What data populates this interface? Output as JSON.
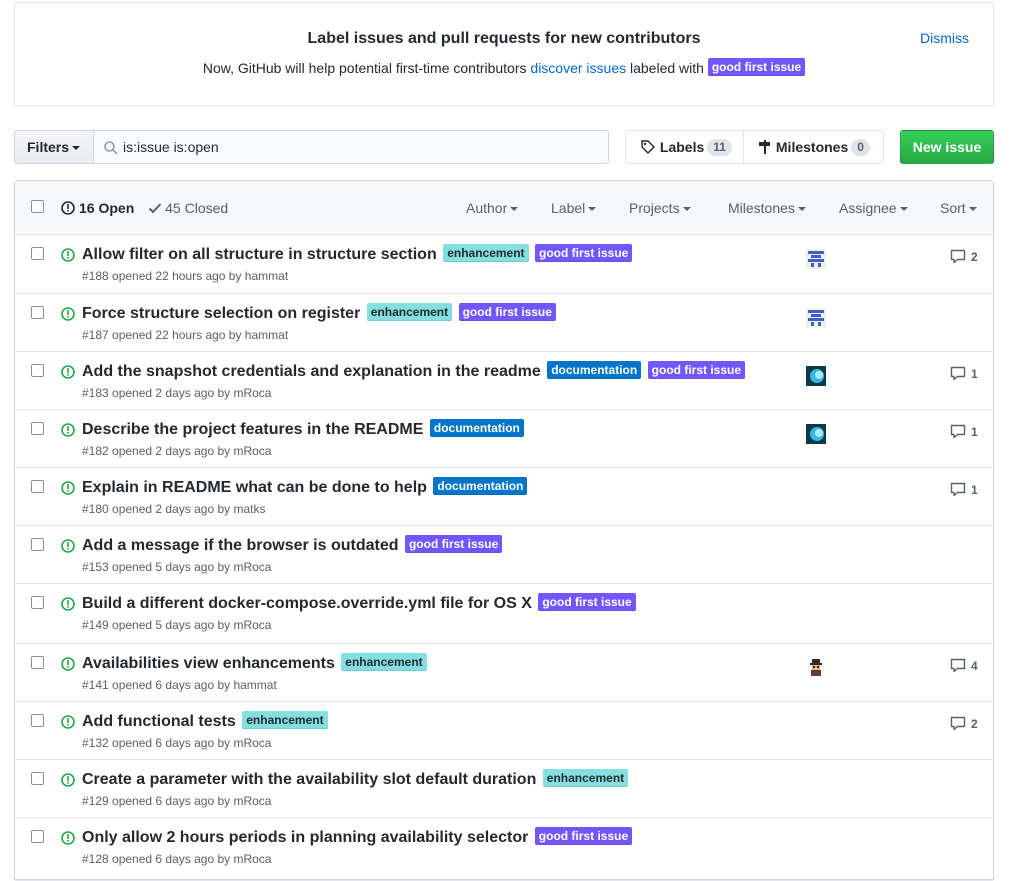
{
  "banner": {
    "title": "Label issues and pull requests for new contributors",
    "desc_prefix": "Now, GitHub will help potential first-time contributors",
    "desc_link": "discover issues",
    "desc_suffix": "labeled with",
    "label": "good first issue",
    "dismiss": "Dismiss"
  },
  "toolbar": {
    "filters_label": "Filters",
    "search_value": "is:issue is:open",
    "labels_label": "Labels",
    "labels_count": "11",
    "milestones_label": "Milestones",
    "milestones_count": "0",
    "new_issue_label": "New issue"
  },
  "list_header": {
    "open_label": "16 Open",
    "closed_label": "45 Closed",
    "filters": [
      "Author",
      "Label",
      "Projects",
      "Milestones",
      "Assignee",
      "Sort"
    ]
  },
  "colors": {
    "enhancement_bg": "#84e0e0",
    "enhancement_fg": "#24292e",
    "good_first_issue_bg": "#7057ff",
    "good_first_issue_fg": "#ffffff",
    "documentation_bg": "#0075ca",
    "documentation_fg": "#ffffff",
    "open_icon": "#28a745",
    "accent": "#0366d6"
  },
  "issues": [
    {
      "title": "Allow filter on all structure in structure section",
      "labels": [
        "enhancement",
        "good first issue"
      ],
      "meta": "#188 opened 22 hours ago by hammat",
      "avatar": "pixel-blue",
      "comments": "2"
    },
    {
      "title": "Force structure selection on register",
      "labels": [
        "enhancement",
        "good first issue"
      ],
      "meta": "#187 opened 22 hours ago by hammat",
      "avatar": "pixel-blue",
      "comments": ""
    },
    {
      "title": "Add the snapshot credentials and explanation in the readme",
      "labels": [
        "documentation",
        "good first issue"
      ],
      "meta": "#183 opened 2 days ago by mRoca",
      "avatar": "cyan-circle",
      "comments": "1"
    },
    {
      "title": "Describe the project features in the README",
      "labels": [
        "documentation"
      ],
      "meta": "#182 opened 2 days ago by mRoca",
      "avatar": "cyan-circle",
      "comments": "1"
    },
    {
      "title": "Explain in README what can be done to help",
      "labels": [
        "documentation"
      ],
      "meta": "#180 opened 2 days ago by matks",
      "avatar": "",
      "comments": "1"
    },
    {
      "title": "Add a message if the browser is outdated",
      "labels": [
        "good first issue"
      ],
      "meta": "#153 opened 5 days ago by mRoca",
      "avatar": "",
      "comments": ""
    },
    {
      "title": "Build a different docker-compose.override.yml file for OS X",
      "labels": [
        "good first issue"
      ],
      "meta": "#149 opened 5 days ago by mRoca",
      "avatar": "",
      "comments": ""
    },
    {
      "title": "Availabilities view enhancements",
      "labels": [
        "enhancement"
      ],
      "meta": "#141 opened 6 days ago by hammat",
      "avatar": "character",
      "comments": "4"
    },
    {
      "title": "Add functional tests",
      "labels": [
        "enhancement"
      ],
      "meta": "#132 opened 6 days ago by mRoca",
      "avatar": "",
      "comments": "2"
    },
    {
      "title": "Create a parameter with the availability slot default duration",
      "labels": [
        "enhancement"
      ],
      "meta": "#129 opened 6 days ago by mRoca",
      "avatar": "",
      "comments": ""
    },
    {
      "title": "Only allow 2 hours periods in planning availability selector",
      "labels": [
        "good first issue"
      ],
      "meta": "#128 opened 6 days ago by mRoca",
      "avatar": "",
      "comments": ""
    }
  ]
}
